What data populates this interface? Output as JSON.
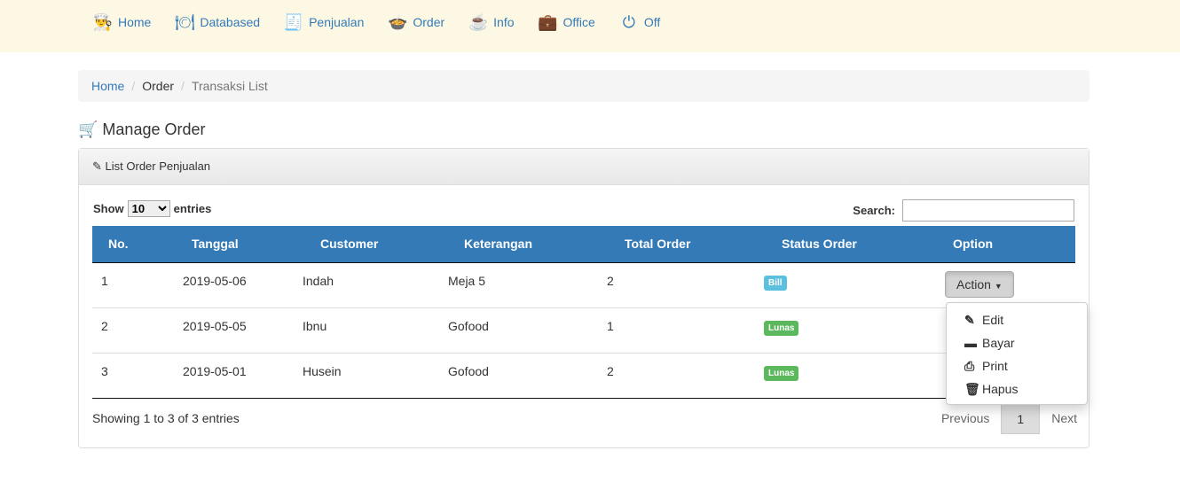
{
  "nav": [
    {
      "label": "Home",
      "icon": "chef-icon",
      "glyph": "👨‍🍳"
    },
    {
      "label": "Databased",
      "icon": "plate-icon",
      "glyph": "🍽"
    },
    {
      "label": "Penjualan",
      "icon": "cash-register-icon",
      "glyph": "🧾"
    },
    {
      "label": "Order",
      "icon": "food-dish-icon",
      "glyph": "🍲"
    },
    {
      "label": "Info",
      "icon": "coffee-cup-icon",
      "glyph": "☕"
    },
    {
      "label": "Office",
      "icon": "suitcase-icon",
      "glyph": "💼"
    },
    {
      "label": "Off",
      "icon": "power-icon",
      "glyph": "⏻"
    }
  ],
  "breadcrumb": {
    "home": "Home",
    "order": "Order",
    "current": "Transaksi List"
  },
  "title": "Manage Order",
  "panel_title": "List Order Penjualan",
  "show": {
    "label_before": "Show",
    "value": "10",
    "label_after": "entries"
  },
  "search": {
    "label": "Search:",
    "value": ""
  },
  "table": {
    "headers": [
      "No.",
      "Tanggal",
      "Customer",
      "Keterangan",
      "Total Order",
      "Status Order",
      "Option"
    ],
    "rows": [
      {
        "no": "1",
        "tanggal": "2019-05-06",
        "customer": "Indah",
        "ket": "Meja 5",
        "total": "2",
        "status": "Bill",
        "color": "#5bc0de",
        "action": "Action"
      },
      {
        "no": "2",
        "tanggal": "2019-05-05",
        "customer": "Ibnu",
        "ket": "Gofood",
        "total": "1",
        "status": "Lunas",
        "color": "#5cb85c"
      },
      {
        "no": "3",
        "tanggal": "2019-05-01",
        "customer": "Husein",
        "ket": "Gofood",
        "total": "2",
        "status": "Lunas",
        "color": "#5cb85c"
      }
    ]
  },
  "menu": [
    {
      "label": "Edit",
      "glyph": "✎",
      "icon": "edit-icon"
    },
    {
      "label": "Bayar",
      "glyph": "▬",
      "icon": "credit-card-icon"
    },
    {
      "label": "Print",
      "glyph": "⎙",
      "icon": "print-icon"
    },
    {
      "label": "Hapus",
      "glyph": "🗑",
      "icon": "trash-icon"
    }
  ],
  "footer": {
    "info": "Showing 1 to 3 of 3 entries",
    "previous": "Previous",
    "page": "1",
    "next": "Next"
  }
}
